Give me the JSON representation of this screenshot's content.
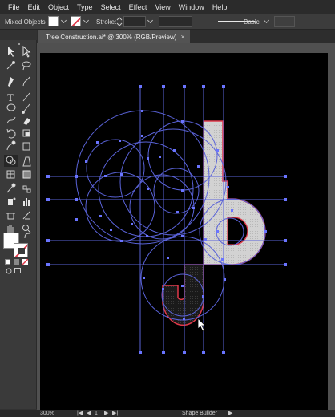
{
  "menu": [
    "File",
    "Edit",
    "Object",
    "Type",
    "Select",
    "Effect",
    "View",
    "Window",
    "Help"
  ],
  "control": {
    "selection_label": "Mixed Objects",
    "stroke_label": "Stroke:",
    "style_label": "Basic"
  },
  "document_tab": {
    "title": "Tree Construction.ai* @ 300% (RGB/Preview)",
    "close": "×"
  },
  "status": {
    "zoom": "300%",
    "page": "1",
    "tool": "Shape Builder"
  },
  "colors": {
    "guide": "#5a63d9",
    "shape_fill": "#d4d4d4",
    "selected_stroke": "#e0394a",
    "anchor": "#6a74ff"
  },
  "icons": [
    "selection-tool-icon",
    "direct-selection-tool-icon",
    "pen-tool-icon",
    "curvature-tool-icon",
    "type-tool-icon",
    "line-tool-icon",
    "ellipse-tool-icon",
    "paintbrush-tool-icon",
    "shaper-tool-icon",
    "eraser-tool-icon",
    "rotate-tool-icon",
    "scale-tool-icon",
    "warp-tool-icon",
    "free-transform-tool-icon",
    "shape-builder-tool-icon",
    "perspective-tool-icon",
    "mesh-tool-icon",
    "gradient-tool-icon",
    "eyedropper-tool-icon",
    "blend-tool-icon",
    "symbol-sprayer-tool-icon",
    "graph-tool-icon",
    "artboard-tool-icon",
    "slice-tool-icon",
    "hand-tool-icon",
    "zoom-tool-icon"
  ]
}
